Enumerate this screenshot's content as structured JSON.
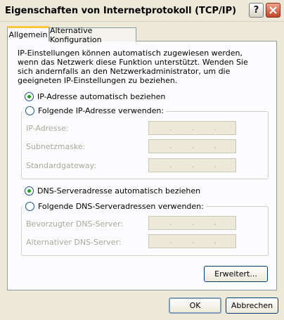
{
  "window": {
    "title": "Eigenschaften von Internetprotokoll (TCP/IP)",
    "help_glyph": "?",
    "close_glyph": "✕"
  },
  "tabs": [
    {
      "label": "Allgemein",
      "active": true
    },
    {
      "label": "Alternative Konfiguration",
      "active": false
    }
  ],
  "intro_text": "IP-Einstellungen können automatisch zugewiesen werden, wenn das Netzwerk diese Funktion unterstützt. Wenden Sie sich andernfalls an den Netzwerkadministrator, um die geeigneten IP-Einstellungen zu beziehen.",
  "ip_section": {
    "auto_label": "IP-Adresse automatisch beziehen",
    "manual_label": "Folgende IP-Adresse verwenden:",
    "selected": "auto",
    "fields": [
      {
        "label": "IP-Adresse:",
        "value": ""
      },
      {
        "label": "Subnetzmaske:",
        "value": ""
      },
      {
        "label": "Standardgateway:",
        "value": ""
      }
    ]
  },
  "dns_section": {
    "auto_label": "DNS-Serveradresse automatisch beziehen",
    "manual_label": "Folgende DNS-Serveradressen verwenden:",
    "selected": "auto",
    "fields": [
      {
        "label": "Bevorzugter DNS-Server:",
        "value": ""
      },
      {
        "label": "Alternativer DNS-Server:",
        "value": ""
      }
    ]
  },
  "buttons": {
    "advanced": "Erweitert...",
    "ok": "OK",
    "cancel": "Abbrechen"
  },
  "ip_separator": "."
}
